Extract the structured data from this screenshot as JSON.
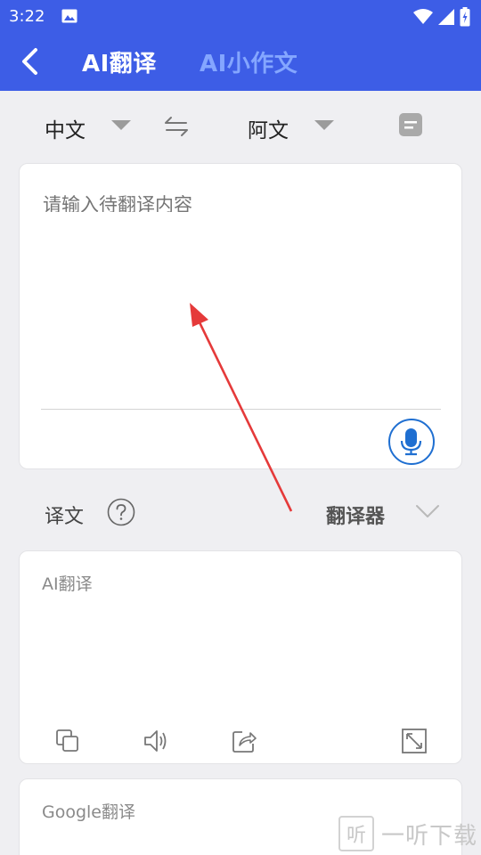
{
  "status_bar": {
    "time": "3:22"
  },
  "header": {
    "tab_active": "AI翻译",
    "tab_inactive": "AI小作文"
  },
  "lang_row": {
    "source_lang": "中文",
    "target_lang": "阿文"
  },
  "input": {
    "placeholder": "请输入待翻译内容"
  },
  "output_row": {
    "label": "译文",
    "engine": "翻译器"
  },
  "result_card": {
    "title": "AI翻译"
  },
  "google_card": {
    "title": "Google翻译"
  },
  "watermark": {
    "icon_char": "听",
    "text": "一听下载"
  },
  "colors": {
    "primary": "#3d5de6",
    "inactive_tab": "#84a6ff",
    "mic": "#1f6fd1",
    "annotation_arrow": "#e53a3a"
  },
  "icons": [
    "back-arrow-icon",
    "swap-icon",
    "note-icon",
    "mic-icon",
    "help-icon",
    "chevron-down-icon",
    "copy-icon",
    "speaker-icon",
    "share-icon",
    "expand-icon"
  ]
}
